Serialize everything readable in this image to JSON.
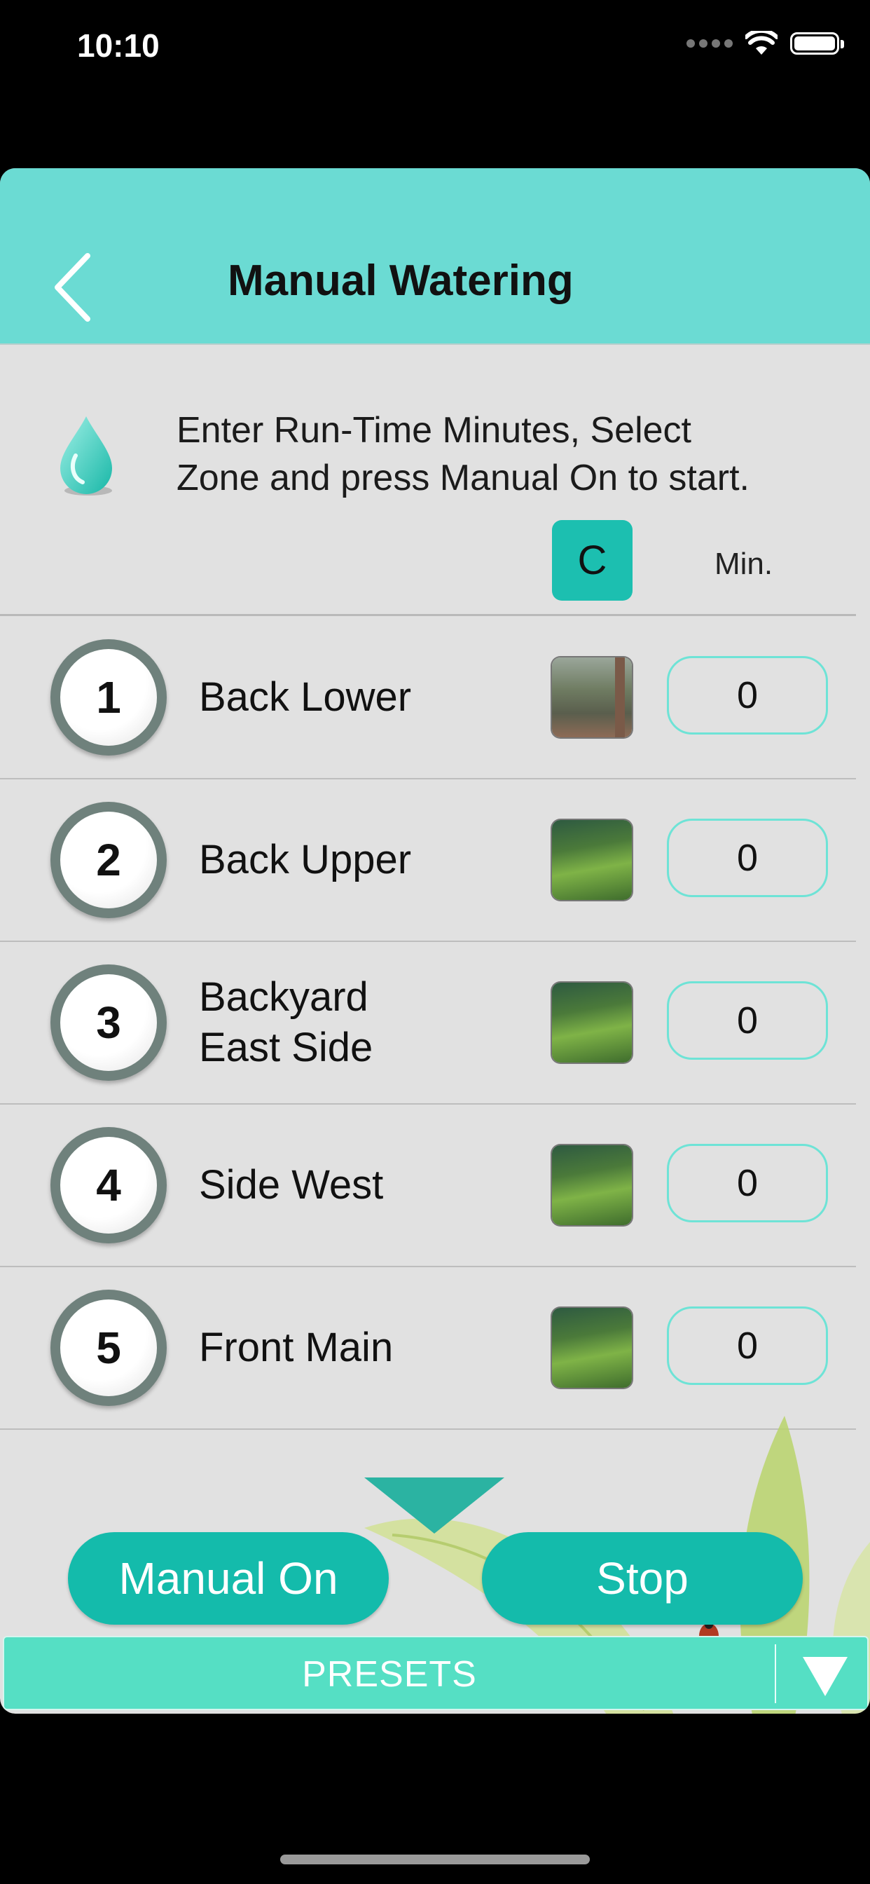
{
  "status_bar": {
    "time": "10:10"
  },
  "nav": {
    "title": "Manual Watering",
    "back_icon": "chevron-left-icon"
  },
  "intro": {
    "line1": "Enter Run-Time Minutes, Select",
    "line2": "Zone and press Manual On to start.",
    "icon": "water-drop-icon"
  },
  "header": {
    "clear_label": "C",
    "min_label": "Min."
  },
  "zones": [
    {
      "number": "1",
      "name": "Back Lower",
      "minutes": "0"
    },
    {
      "number": "2",
      "name": "Back Upper",
      "minutes": "0"
    },
    {
      "number": "3",
      "name_line1": "Backyard",
      "name_line2": "East Side",
      "minutes": "0"
    },
    {
      "number": "4",
      "name": "Side West",
      "minutes": "0"
    },
    {
      "number": "5",
      "name": "Front Main",
      "minutes": "0"
    }
  ],
  "actions": {
    "manual_on": "Manual On",
    "stop": "Stop"
  },
  "presets": {
    "label": "PRESETS"
  },
  "colors": {
    "nav_bg": "#6bdbd3",
    "accent": "#14bbab",
    "presets_bg": "#55dfc4",
    "body_bg": "#e1e1e1"
  }
}
